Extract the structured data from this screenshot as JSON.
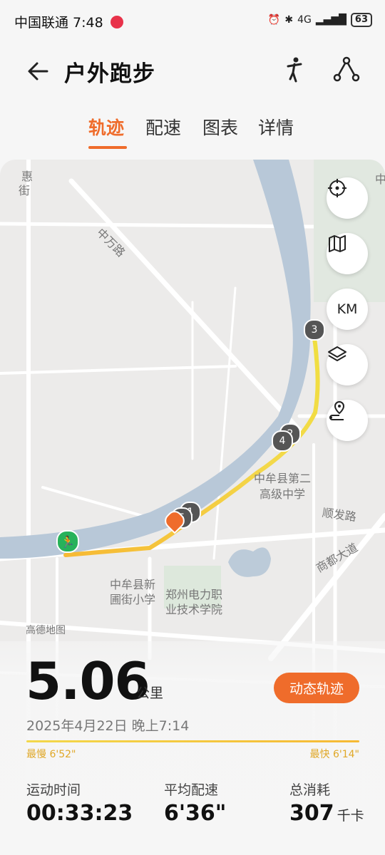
{
  "status_bar": {
    "carrier_time": "中国联通 7:48",
    "network": "4G",
    "battery": "63"
  },
  "header": {
    "title": "户外跑步"
  },
  "tabs": [
    {
      "label": "轨迹"
    },
    {
      "label": "配速"
    },
    {
      "label": "图表"
    },
    {
      "label": "详情"
    }
  ],
  "map": {
    "labels": {
      "hui_street_1": "惠",
      "hui_street_2": "街",
      "zhongwan_road": "中万路",
      "school_1_line1": "中牟县第二",
      "school_1_line2": "高级中学",
      "shunfa_road": "顺发路",
      "shangdu_avenue": "商都大道",
      "school_2_line1": "中牟县新",
      "school_2_line2": "圃街小学",
      "college_line1": "郑州电力职",
      "college_line2": "业技术学院",
      "attribution": "高德地图",
      "corner_label": "中"
    },
    "controls": {
      "km_label": "KM"
    },
    "markers": [
      "1",
      "2",
      "3",
      "4",
      "5"
    ],
    "route_color_slow": "#f3d84a",
    "route_color_fast": "#f6b934",
    "start_color": "#27b25a",
    "end_color": "#ef6c2b"
  },
  "summary": {
    "distance": "5.06",
    "distance_unit": "公里",
    "dynamic_track_button": "动态轨迹",
    "date": "2025年4月22日 晚上7:14",
    "slowest_label": "最慢 6'52\"",
    "fastest_label": "最快 6'14\"",
    "stats": [
      {
        "label": "运动时间",
        "value": "00:33:23",
        "unit": ""
      },
      {
        "label": "平均配速",
        "value": "6'36\"",
        "unit": ""
      },
      {
        "label": "总消耗",
        "value": "307",
        "unit": "千卡"
      }
    ]
  },
  "colors": {
    "accent": "#ef6c2b",
    "river": "#b8c8d8"
  }
}
